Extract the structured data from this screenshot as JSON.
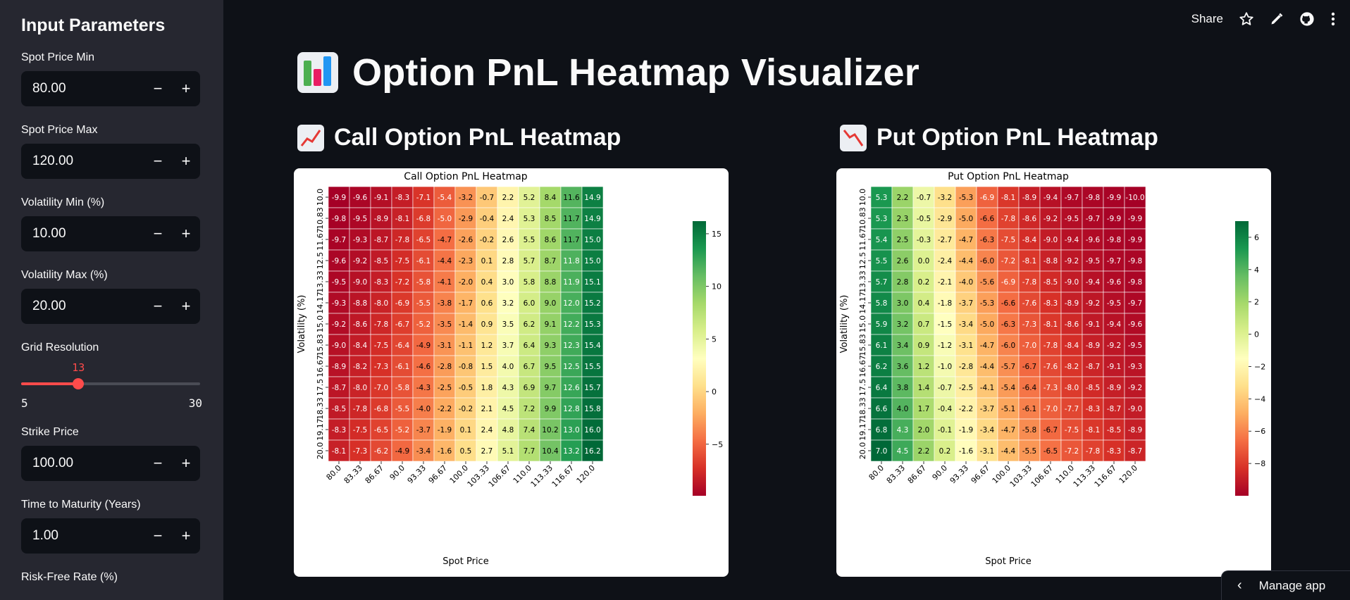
{
  "sidebar": {
    "title": "Input Parameters",
    "fields": [
      {
        "label": "Spot Price Min",
        "value": "80.00"
      },
      {
        "label": "Spot Price Max",
        "value": "120.00"
      },
      {
        "label": "Volatility Min (%)",
        "value": "10.00"
      },
      {
        "label": "Volatility Max (%)",
        "value": "20.00"
      }
    ],
    "slider": {
      "label": "Grid Resolution",
      "value": "13",
      "min": "5",
      "max": "30",
      "fraction": 0.32
    },
    "fields2": [
      {
        "label": "Strike Price",
        "value": "100.00"
      },
      {
        "label": "Time to Maturity (Years)",
        "value": "1.00"
      }
    ],
    "partial_label": "Risk-Free Rate (%)",
    "minus": "−",
    "plus": "+"
  },
  "topbar": {
    "share": "Share"
  },
  "main": {
    "title": "Option PnL Heatmap Visualizer",
    "call_section": "Call Option PnL Heatmap",
    "put_section": "Put Option PnL Heatmap"
  },
  "manage_app": "Manage app",
  "chart_data": [
    {
      "type": "heatmap",
      "title": "Call Option PnL Heatmap",
      "xlabel": "Spot Price",
      "ylabel": "Volatility (%)",
      "x": [
        "80.0",
        "83.33",
        "86.67",
        "90.0",
        "93.33",
        "96.67",
        "100.0",
        "103.33",
        "106.67",
        "110.0",
        "113.33",
        "116.67",
        "120.0"
      ],
      "y": [
        "10.0",
        "10.83",
        "11.67",
        "12.5",
        "13.33",
        "14.17",
        "15.0",
        "15.83",
        "16.67",
        "17.5",
        "18.33",
        "19.17",
        "20.0"
      ],
      "z": [
        [
          -9.9,
          -9.6,
          -9.1,
          -8.3,
          -7.1,
          -5.4,
          -3.2,
          -0.7,
          2.2,
          5.2,
          8.4,
          11.6,
          14.9
        ],
        [
          -9.8,
          -9.5,
          -8.9,
          -8.1,
          -6.8,
          -5.0,
          -2.9,
          -0.4,
          2.4,
          5.3,
          8.5,
          11.7,
          14.9
        ],
        [
          -9.7,
          -9.3,
          -8.7,
          -7.8,
          -6.5,
          -4.7,
          -2.6,
          -0.2,
          2.6,
          5.5,
          8.6,
          11.7,
          15.0
        ],
        [
          -9.6,
          -9.2,
          -8.5,
          -7.5,
          -6.1,
          -4.4,
          -2.3,
          0.1,
          2.8,
          5.7,
          8.7,
          11.8,
          15.0
        ],
        [
          -9.5,
          -9.0,
          -8.3,
          -7.2,
          -5.8,
          -4.1,
          -2.0,
          0.4,
          3.0,
          5.8,
          8.8,
          11.9,
          15.1
        ],
        [
          -9.3,
          -8.8,
          -8.0,
          -6.9,
          -5.5,
          -3.8,
          -1.7,
          0.6,
          3.2,
          6.0,
          9.0,
          12.0,
          15.2
        ],
        [
          -9.2,
          -8.6,
          -7.8,
          -6.7,
          -5.2,
          -3.5,
          -1.4,
          0.9,
          3.5,
          6.2,
          9.1,
          12.2,
          15.3
        ],
        [
          -9.0,
          -8.4,
          -7.5,
          -6.4,
          -4.9,
          -3.1,
          -1.1,
          1.2,
          3.7,
          6.4,
          9.3,
          12.3,
          15.4
        ],
        [
          -8.9,
          -8.2,
          -7.3,
          -6.1,
          -4.6,
          -2.8,
          -0.8,
          1.5,
          4.0,
          6.7,
          9.5,
          12.5,
          15.5
        ],
        [
          -8.7,
          -8.0,
          -7.0,
          -5.8,
          -4.3,
          -2.5,
          -0.5,
          1.8,
          4.3,
          6.9,
          9.7,
          12.6,
          15.7
        ],
        [
          -8.5,
          -7.8,
          -6.8,
          -5.5,
          -4.0,
          -2.2,
          -0.2,
          2.1,
          4.5,
          7.2,
          9.9,
          12.8,
          15.8
        ],
        [
          -8.3,
          -7.5,
          -6.5,
          -5.2,
          -3.7,
          -1.9,
          0.1,
          2.4,
          4.8,
          7.4,
          10.2,
          13.0,
          16.0
        ],
        [
          -8.1,
          -7.3,
          -6.2,
          -4.9,
          -3.4,
          -1.6,
          0.5,
          2.7,
          5.1,
          7.7,
          10.4,
          13.2,
          16.2
        ]
      ],
      "zlim": [
        -9.9,
        16.2
      ],
      "colorbar_ticks": [
        "15",
        "10",
        "5",
        "0",
        "−5"
      ],
      "colorbar_values": [
        15,
        10,
        5,
        0,
        -5
      ],
      "colormap": "RdYlGn"
    },
    {
      "type": "heatmap",
      "title": "Put Option PnL Heatmap",
      "xlabel": "Spot Price",
      "ylabel": "Volatility (%)",
      "x": [
        "80.0",
        "83.33",
        "86.67",
        "90.0",
        "93.33",
        "96.67",
        "100.0",
        "103.33",
        "106.67",
        "110.0",
        "113.33",
        "116.67",
        "120.0"
      ],
      "y": [
        "10.0",
        "10.83",
        "11.67",
        "12.5",
        "13.33",
        "14.17",
        "15.0",
        "15.83",
        "16.67",
        "17.5",
        "18.33",
        "19.17",
        "20.0"
      ],
      "z": [
        [
          5.3,
          2.2,
          -0.7,
          -3.2,
          -5.3,
          -6.9,
          -8.1,
          -8.9,
          -9.4,
          -9.7,
          -9.8,
          -9.9,
          -10.0
        ],
        [
          5.3,
          2.3,
          -0.5,
          -2.9,
          -5.0,
          -6.6,
          -7.8,
          -8.6,
          -9.2,
          -9.5,
          -9.7,
          -9.9,
          -9.9
        ],
        [
          5.4,
          2.5,
          -0.3,
          -2.7,
          -4.7,
          -6.3,
          -7.5,
          -8.4,
          -9.0,
          -9.4,
          -9.6,
          -9.8,
          -9.9
        ],
        [
          5.5,
          2.6,
          -0.0,
          -2.4,
          -4.4,
          -6.0,
          -7.2,
          -8.1,
          -8.8,
          -9.2,
          -9.5,
          -9.7,
          -9.8
        ],
        [
          5.7,
          2.8,
          0.2,
          -2.1,
          -4.0,
          -5.6,
          -6.9,
          -7.8,
          -8.5,
          -9.0,
          -9.4,
          -9.6,
          -9.8
        ],
        [
          5.8,
          3.0,
          0.4,
          -1.8,
          -3.7,
          -5.3,
          -6.6,
          -7.6,
          -8.3,
          -8.9,
          -9.2,
          -9.5,
          -9.7
        ],
        [
          5.9,
          3.2,
          0.7,
          -1.5,
          -3.4,
          -5.0,
          -6.3,
          -7.3,
          -8.1,
          -8.6,
          -9.1,
          -9.4,
          -9.6
        ],
        [
          6.1,
          3.4,
          0.9,
          -1.2,
          -3.1,
          -4.7,
          -6.0,
          -7.0,
          -7.8,
          -8.4,
          -8.9,
          -9.2,
          -9.5
        ],
        [
          6.2,
          3.6,
          1.2,
          -1.0,
          -2.8,
          -4.4,
          -5.7,
          -6.7,
          -7.6,
          -8.2,
          -8.7,
          -9.1,
          -9.3
        ],
        [
          6.4,
          3.8,
          1.4,
          -0.7,
          -2.5,
          -4.1,
          -5.4,
          -6.4,
          -7.3,
          -8.0,
          -8.5,
          -8.9,
          -9.2
        ],
        [
          6.6,
          4.0,
          1.7,
          -0.4,
          -2.2,
          -3.7,
          -5.1,
          -6.1,
          -7.0,
          -7.7,
          -8.3,
          -8.7,
          -9.0
        ],
        [
          6.8,
          4.3,
          2.0,
          -0.1,
          -1.9,
          -3.4,
          -4.7,
          -5.8,
          -6.7,
          -7.5,
          -8.1,
          -8.5,
          -8.9
        ],
        [
          7.0,
          4.5,
          2.2,
          0.2,
          -1.6,
          -3.1,
          -4.4,
          -5.5,
          -6.5,
          -7.2,
          -7.8,
          -8.3,
          -8.7
        ]
      ],
      "zlim": [
        -10.0,
        7.0
      ],
      "colorbar_ticks": [
        "6",
        "4",
        "2",
        "0",
        "−2",
        "−4",
        "−6",
        "−8"
      ],
      "colorbar_values": [
        6,
        4,
        2,
        0,
        -2,
        -4,
        -6,
        -8
      ],
      "colormap": "RdYlGn"
    }
  ]
}
